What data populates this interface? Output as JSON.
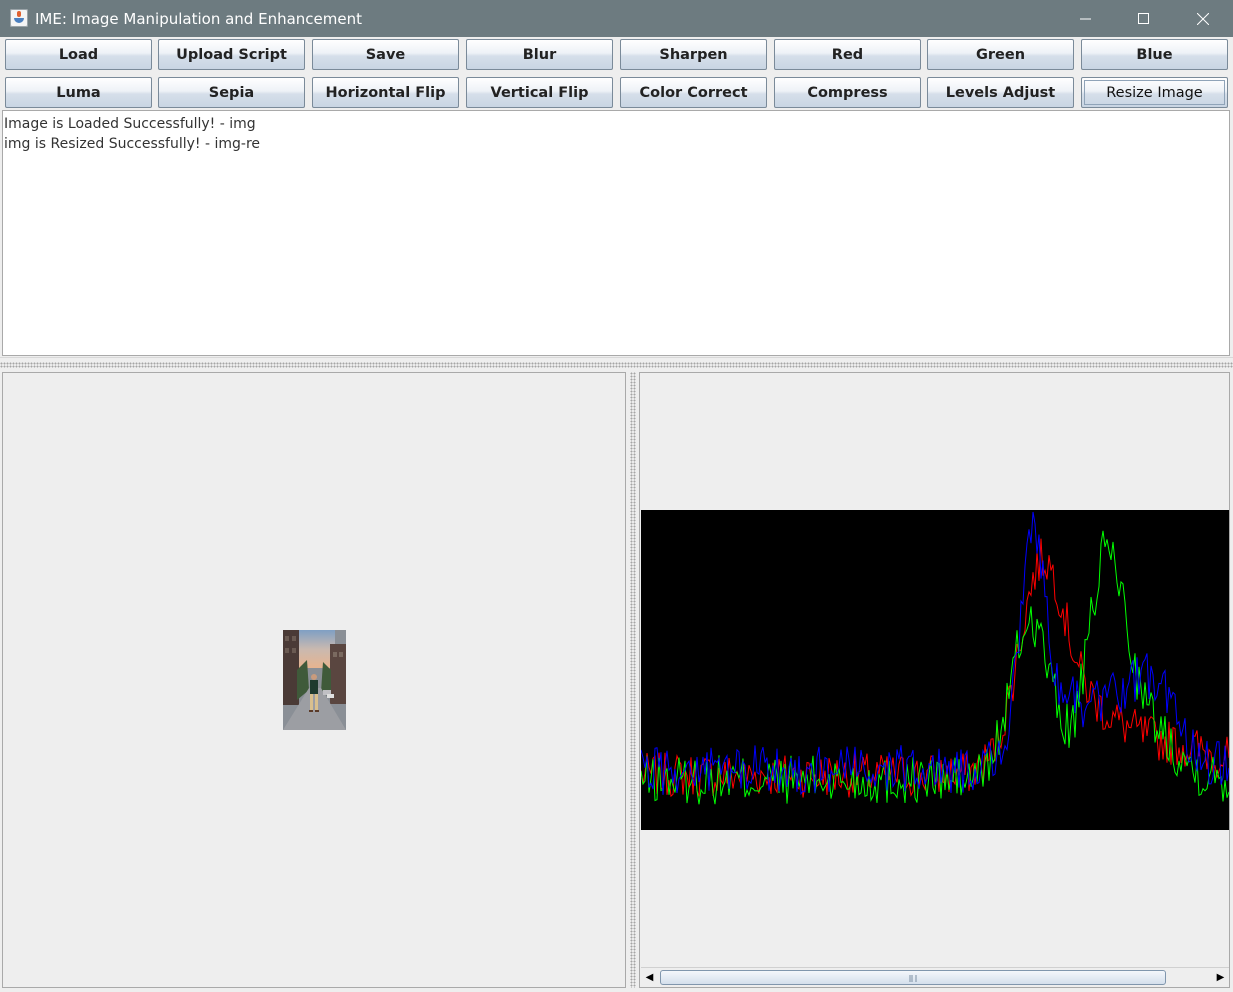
{
  "window": {
    "title": "IME: Image Manipulation and Enhancement"
  },
  "toolbar": {
    "row1": [
      "Load",
      "Upload Script",
      "Save",
      "Blur",
      "Sharpen",
      "Red",
      "Green",
      "Blue"
    ],
    "row2": [
      "Luma",
      "Sepia",
      "Horizontal Flip",
      "Vertical Flip",
      "Color Correct",
      "Compress",
      "Levels Adjust",
      "Resize Image"
    ],
    "focused": "Resize Image"
  },
  "log": {
    "lines": [
      "Image is Loaded Successfully! - img",
      "img is Resized Successfully! - img-re"
    ]
  },
  "histogram": {
    "colors": {
      "red": "#ff0000",
      "green": "#00ff00",
      "blue": "#0000ff",
      "background": "#000000"
    },
    "scroll_position": 0.02,
    "scroll_visible_fraction": 0.92
  }
}
